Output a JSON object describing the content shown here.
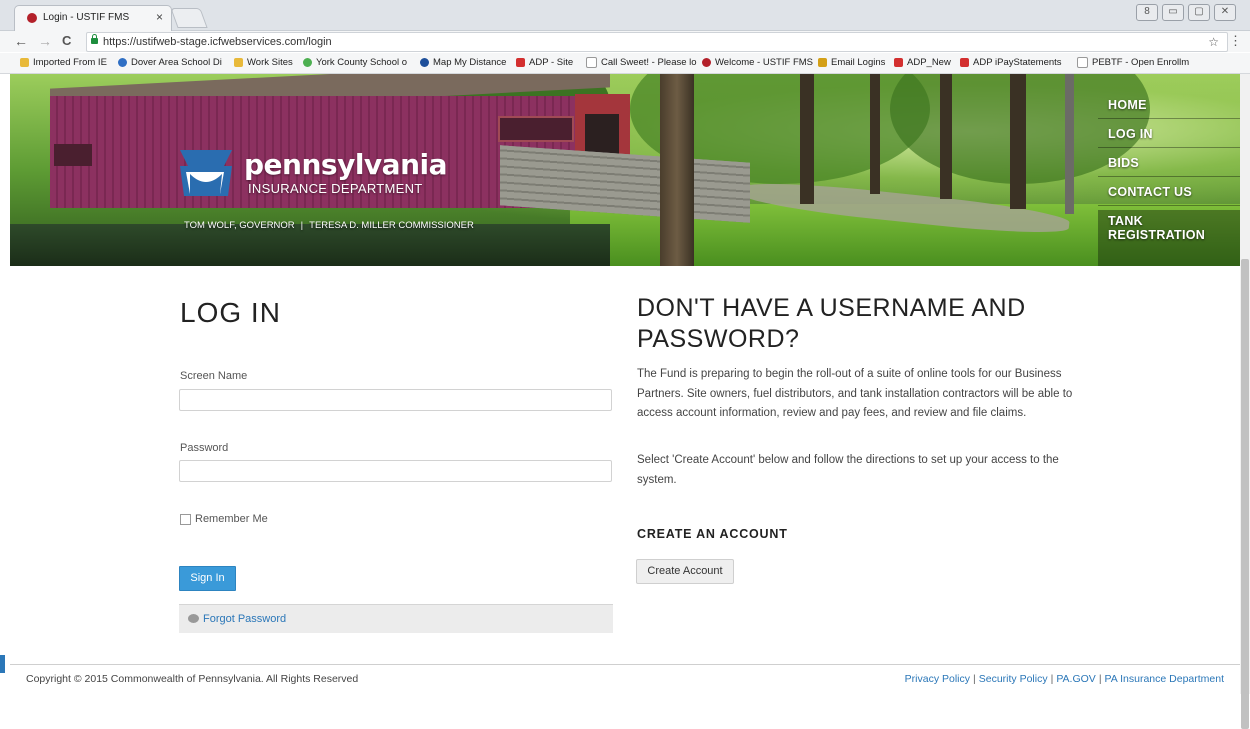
{
  "browser": {
    "tab_title": "Login - USTIF FMS",
    "tab_close": "×",
    "url": "https://ustifweb-stage.icfwebservices.com/login",
    "back": "←",
    "forward": "→",
    "reload": "C",
    "star": "☆",
    "menu": "⋮",
    "window_controls": [
      "8",
      "▭",
      "▢",
      "✕"
    ],
    "bookmarks": [
      {
        "label": "Imported From IE",
        "color": "#e8b93a"
      },
      {
        "label": "Dover Area School Di",
        "color": "#2f6fc4"
      },
      {
        "label": "Work Sites",
        "color": "#e8b93a"
      },
      {
        "label": "York County School o",
        "color": "#4caf50"
      },
      {
        "label": "Map My Distance",
        "color": "#1e4f9a"
      },
      {
        "label": "ADP - Site",
        "color": "#d32f2f"
      },
      {
        "label": "Call Sweet! - Please lo",
        "color": "#9e9e9e"
      },
      {
        "label": "Welcome - USTIF FMS",
        "color": "#b3202a"
      },
      {
        "label": "Email Logins",
        "color": "#d4a017"
      },
      {
        "label": "ADP_New",
        "color": "#d32f2f"
      },
      {
        "label": "ADP iPayStatements",
        "color": "#d32f2f"
      },
      {
        "label": "PEBTF - Open Enrollm",
        "color": "#9e9e9e"
      }
    ]
  },
  "banner": {
    "logo_title": "pennsylvania",
    "logo_subtitle": "INSURANCE DEPARTMENT",
    "governor": "TOM WOLF, GOVERNOR",
    "separator": "|",
    "commissioner": "TERESA D. MILLER COMMISSIONER",
    "nav": {
      "home": "HOME",
      "login": "LOG IN",
      "bids": "BIDS",
      "contact": "CONTACT US",
      "tank_line1": "TANK",
      "tank_line2": "REGISTRATION"
    }
  },
  "login": {
    "title": "LOG IN",
    "screen_name_label": "Screen Name",
    "screen_name_value": "",
    "password_label": "Password",
    "password_value": "",
    "remember_label": "Remember Me",
    "remember_checked": false,
    "sign_in": "Sign In",
    "forgot": "Forgot Password"
  },
  "signup": {
    "title": "DON'T HAVE A USERNAME AND PASSWORD?",
    "paragraph1": "The Fund is preparing to begin the roll-out of a suite of online tools for our Business Partners.  Site owners, fuel distributors, and tank installation contractors will be able to access account information, review and pay fees, and review and file claims.",
    "paragraph2": "Select 'Create Account' below and follow the directions to set up your access to the system.",
    "create_heading": "CREATE AN ACCOUNT",
    "create_button": "Create Account"
  },
  "footer": {
    "copyright": "Copyright © 2015 Commonwealth of Pennsylvania. All Rights Reserved",
    "links": [
      "Privacy Policy",
      "Security Policy",
      "PA.GOV",
      "PA Insurance Department"
    ],
    "separator": "|"
  },
  "colors": {
    "accent": "#3a9ad9",
    "link": "#2b77b8"
  }
}
